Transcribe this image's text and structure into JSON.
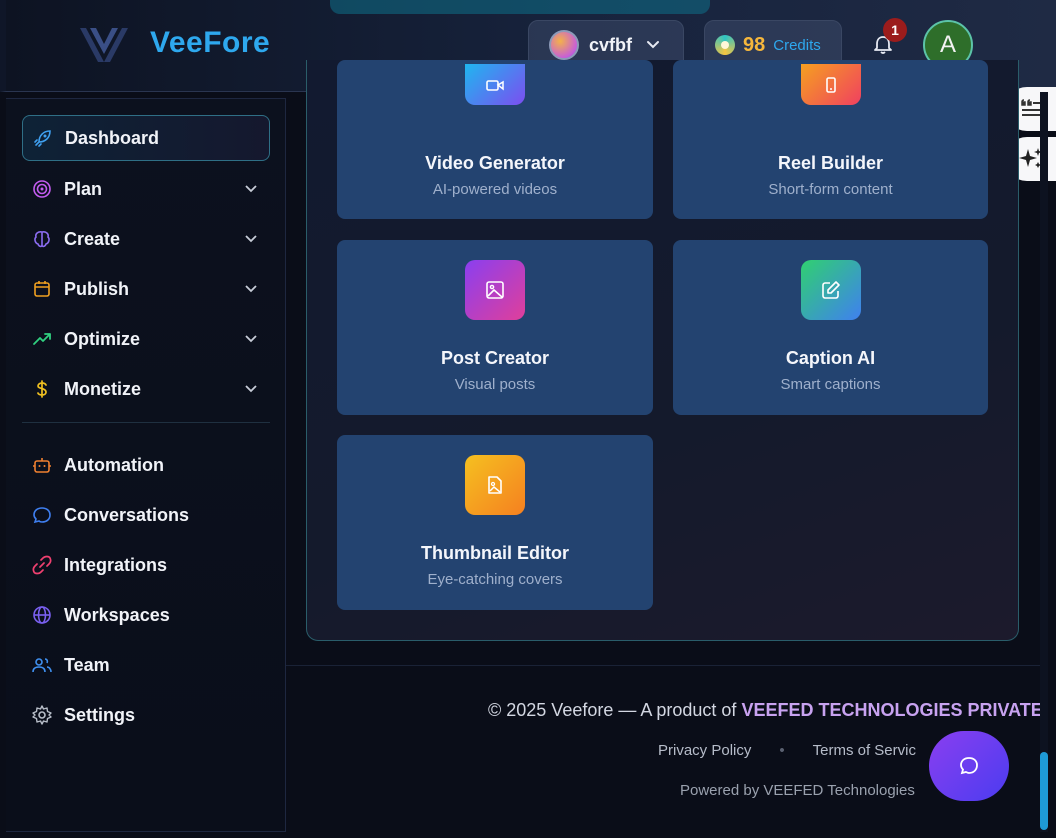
{
  "header": {
    "app_name": "VeeFore",
    "workspace_name": "cvfbf",
    "credits_value": "98",
    "credits_label": "Credits",
    "notification_count": "1",
    "user_initial": "A"
  },
  "sidebar": {
    "items": [
      {
        "label": "Dashboard",
        "icon": "rocket-icon"
      },
      {
        "label": "Plan",
        "icon": "target-icon"
      },
      {
        "label": "Create",
        "icon": "brain-icon"
      },
      {
        "label": "Publish",
        "icon": "calendar-icon"
      },
      {
        "label": "Optimize",
        "icon": "trending-up-icon"
      },
      {
        "label": "Monetize",
        "icon": "dollar-icon"
      },
      {
        "label": "Automation",
        "icon": "bot-icon"
      },
      {
        "label": "Conversations",
        "icon": "chat-bubble-icon"
      },
      {
        "label": "Integrations",
        "icon": "link-icon"
      },
      {
        "label": "Workspaces",
        "icon": "globe-icon"
      },
      {
        "label": "Team",
        "icon": "users-icon"
      },
      {
        "label": "Settings",
        "icon": "gear-icon"
      }
    ]
  },
  "tools": [
    {
      "title": "Video Generator",
      "subtitle": "AI-powered videos",
      "icon": "video-icon"
    },
    {
      "title": "Reel Builder",
      "subtitle": "Short-form content",
      "icon": "phone-icon"
    },
    {
      "title": "Post Creator",
      "subtitle": "Visual posts",
      "icon": "image-icon"
    },
    {
      "title": "Caption AI",
      "subtitle": "Smart captions",
      "icon": "edit-icon"
    },
    {
      "title": "Thumbnail Editor",
      "subtitle": "Eye-catching covers",
      "icon": "image-file-icon"
    }
  ],
  "footer": {
    "copyright_prefix": "© 2025 Veefore — A product of ",
    "copyright_brand": "VEEFED TECHNOLOGIES PRIVATE",
    "privacy": "Privacy Policy",
    "terms": "Terms of Servic",
    "powered": "Powered by VEEFED Technologies"
  },
  "colors": {
    "accent": "#2ea8ee",
    "card_bg": "#234370",
    "credits": "#f6b73c",
    "brand_purple": "#c8a2f0"
  }
}
